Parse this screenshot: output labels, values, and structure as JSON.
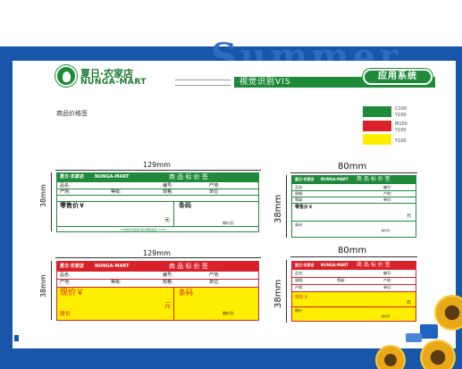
{
  "background": {
    "watermark": "Summer"
  },
  "brand": {
    "name_cn": "夏日·农家店",
    "name_en": "NUNGA-MART"
  },
  "header": {
    "section_bar": "视觉识别VIS",
    "app_button": "应用系统"
  },
  "section_title": "商品价格签",
  "colors": {
    "green": "#1f8a3a",
    "red": "#d8222a",
    "yellow": "#ffee00",
    "blue": "#1756a8",
    "swatches": [
      {
        "color": "#1f8a3a",
        "label_top": "C100",
        "label_bottom": "Y100"
      },
      {
        "color": "#d8222a",
        "label_top": "M100",
        "label_bottom": "Y100"
      },
      {
        "color": "#ffee00",
        "label_top": "",
        "label_bottom": "Y100"
      }
    ]
  },
  "dims": {
    "w_large": "129mm",
    "w_small": "80mm",
    "h": "38mm"
  },
  "tag": {
    "title": "商 品 标 价 签",
    "name": "品名:",
    "code": "编号:",
    "origin": "产地:",
    "spec": "规格:",
    "grade": "等级:",
    "unit": "单位:",
    "retail_price": "零售价￥",
    "sale_price": "现价￥",
    "original_price": "原价",
    "barcode": "条码",
    "yuan": "元",
    "inspector": "物价员:",
    "price_bureau": "物价员:",
    "footer": "XX市物价局监制 物价举报电话:12358"
  }
}
